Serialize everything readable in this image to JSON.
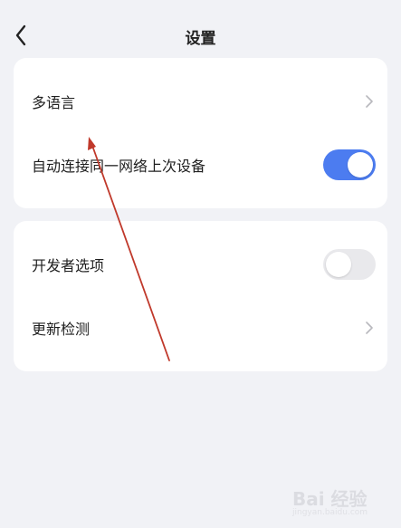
{
  "header": {
    "title": "设置",
    "back_icon": "chevron-left-icon"
  },
  "sections": [
    {
      "items": [
        {
          "label": "多语言",
          "control": "chevron",
          "icon": "chevron-right-icon"
        },
        {
          "label": "自动连接同一网络上次设备",
          "control": "toggle",
          "on": true
        }
      ]
    },
    {
      "items": [
        {
          "label": "开发者选项",
          "control": "toggle",
          "on": false
        },
        {
          "label": "更新检测",
          "control": "chevron",
          "icon": "chevron-right-icon"
        }
      ]
    }
  ],
  "colors": {
    "background": "#f1f2f6",
    "card": "#ffffff",
    "toggle_on": "#4c7cf0",
    "toggle_off": "#e9e9ec",
    "annotation_arrow": "#c0392b"
  },
  "watermark": {
    "main": "Bai 经验",
    "sub": "jingyan.baidu.com"
  }
}
